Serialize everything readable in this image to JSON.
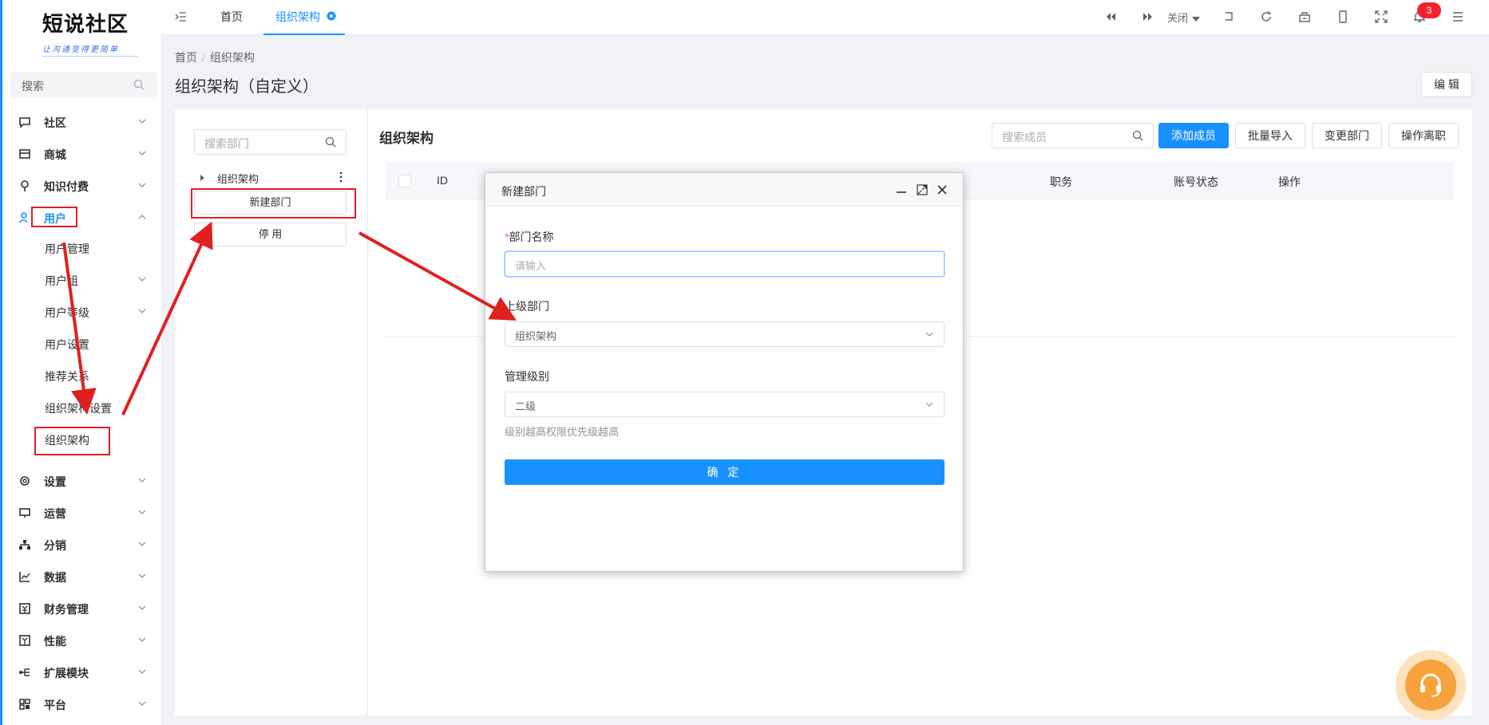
{
  "logo": {
    "title": "短说社区",
    "slogan": "让沟通变得更简单"
  },
  "sidebar": {
    "search_placeholder": "搜索",
    "menu": [
      {
        "label": "社区",
        "icon": "chat-icon"
      },
      {
        "label": "商城",
        "icon": "store-icon"
      },
      {
        "label": "知识付费",
        "icon": "bulb-icon"
      },
      {
        "label": "用户",
        "icon": "user-icon"
      },
      {
        "label": "设置",
        "icon": "gear-icon"
      },
      {
        "label": "运营",
        "icon": "monitor-icon"
      },
      {
        "label": "分销",
        "icon": "network-icon"
      },
      {
        "label": "数据",
        "icon": "chart-icon"
      },
      {
        "label": "财务管理",
        "icon": "finance-icon"
      },
      {
        "label": "性能",
        "icon": "performance-icon"
      },
      {
        "label": "扩展模块",
        "icon": "extension-icon"
      },
      {
        "label": "平台",
        "icon": "platform-icon"
      }
    ],
    "user_sub": [
      {
        "label": "用户管理"
      },
      {
        "label": "用户组"
      },
      {
        "label": "用户等级"
      },
      {
        "label": "用户设置"
      },
      {
        "label": "推荐关系"
      },
      {
        "label": "组织架构设置"
      },
      {
        "label": "组织架构"
      }
    ]
  },
  "header": {
    "tabs": [
      {
        "label": "首页"
      },
      {
        "label": "组织架构"
      }
    ],
    "close_label": "关闭",
    "notification_count": "3"
  },
  "page": {
    "breadcrumb": {
      "home": "首页",
      "sep": "/",
      "current": "组织架构"
    },
    "title": "组织架构（自定义）",
    "edit_label": "编 辑"
  },
  "dept_panel": {
    "search_placeholder": "搜索部门",
    "tree_root": "组织架构",
    "new_dept": "新建部门",
    "disable": "停 用"
  },
  "main": {
    "title": "组织架构",
    "member_search_placeholder": "搜索成员",
    "buttons": {
      "add": "添加成员",
      "import": "批量导入",
      "change": "变更部门",
      "leave": "操作离职"
    },
    "columns": {
      "id": "ID",
      "position": "职务",
      "status": "账号状态",
      "action": "操作"
    }
  },
  "dialog": {
    "title": "新建部门",
    "required_mark": "*",
    "name_label": "部门名称",
    "name_placeholder": "请输入",
    "parent_label": "上级部门",
    "parent_value": "组织架构",
    "level_label": "管理级别",
    "level_value": "二级",
    "level_hint": "级别越高权限优先级越高",
    "submit": "确 定"
  },
  "colors": {
    "primary": "#1890ff",
    "annotation": "#e02020",
    "fab": "#f7a23c"
  }
}
